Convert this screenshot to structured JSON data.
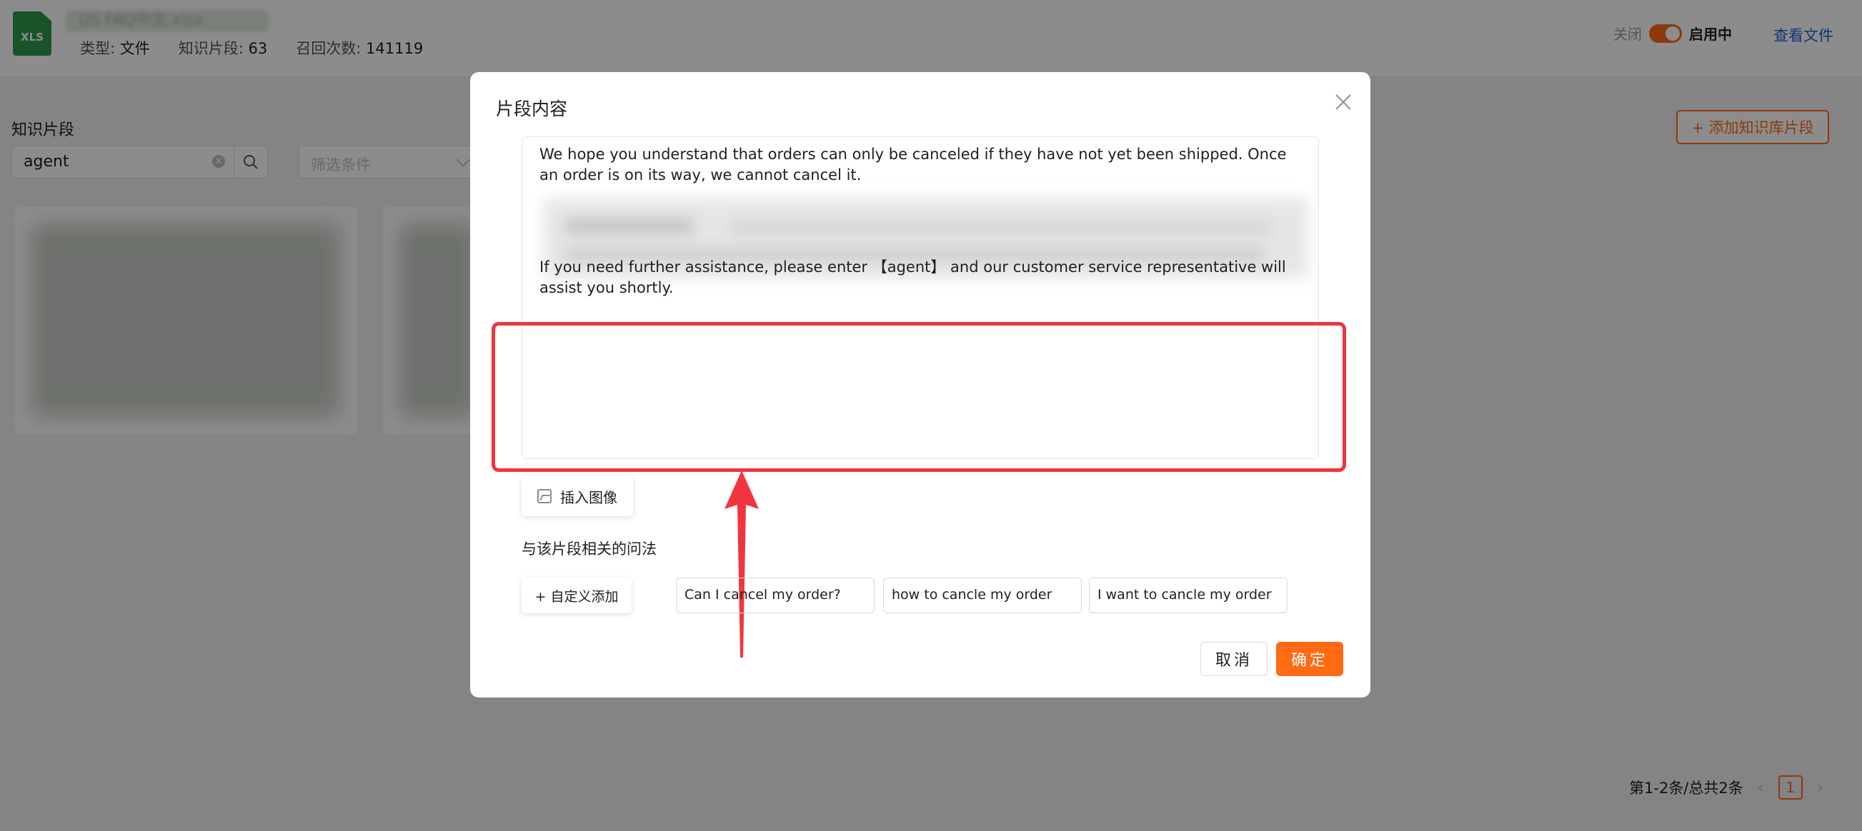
{
  "header": {
    "file_icon_label": "XLS",
    "file_name": "US FAQ中文.xlsx",
    "type_label": "类型:",
    "type_value": "文件",
    "fragments_label": "知识片段:",
    "fragments_value": "63",
    "recall_label": "召回次数:",
    "recall_value": "141119",
    "toggle_off_label": "关闭",
    "toggle_on_label": "启用中",
    "toggle_state": "on",
    "view_file_label": "查看文件"
  },
  "list_page": {
    "section_label": "知识片段",
    "search": {
      "value": "agent"
    },
    "filter": {
      "placeholder": "筛选条件"
    },
    "add_fragment_label": "+ 添加知识库片段",
    "pagination": {
      "summary": "第1-2条/总共2条",
      "current_page": "1"
    }
  },
  "modal": {
    "title": "片段内容",
    "paragraph_1": "We hope you understand that orders can only be canceled if they have not yet been shipped. Once an order is on its way, we cannot cancel it.",
    "paragraph_2": "If you need further assistance, please enter 【agent】 and our customer service representative will assist you shortly.",
    "insert_image_label": "插入图像",
    "related_title": "与该片段相关的问法",
    "custom_add_label": "+ 自定义添加",
    "questions": [
      "Can I cancel my order?",
      "how to cancle my order",
      "I want to cancle my order"
    ],
    "cancel_label": "取消",
    "ok_label": "确定"
  },
  "colors": {
    "accent": "#ff6a13",
    "highlight_red": "#f0353f",
    "link_blue": "#1f5fd4",
    "xls_green": "#2e9a4a"
  }
}
